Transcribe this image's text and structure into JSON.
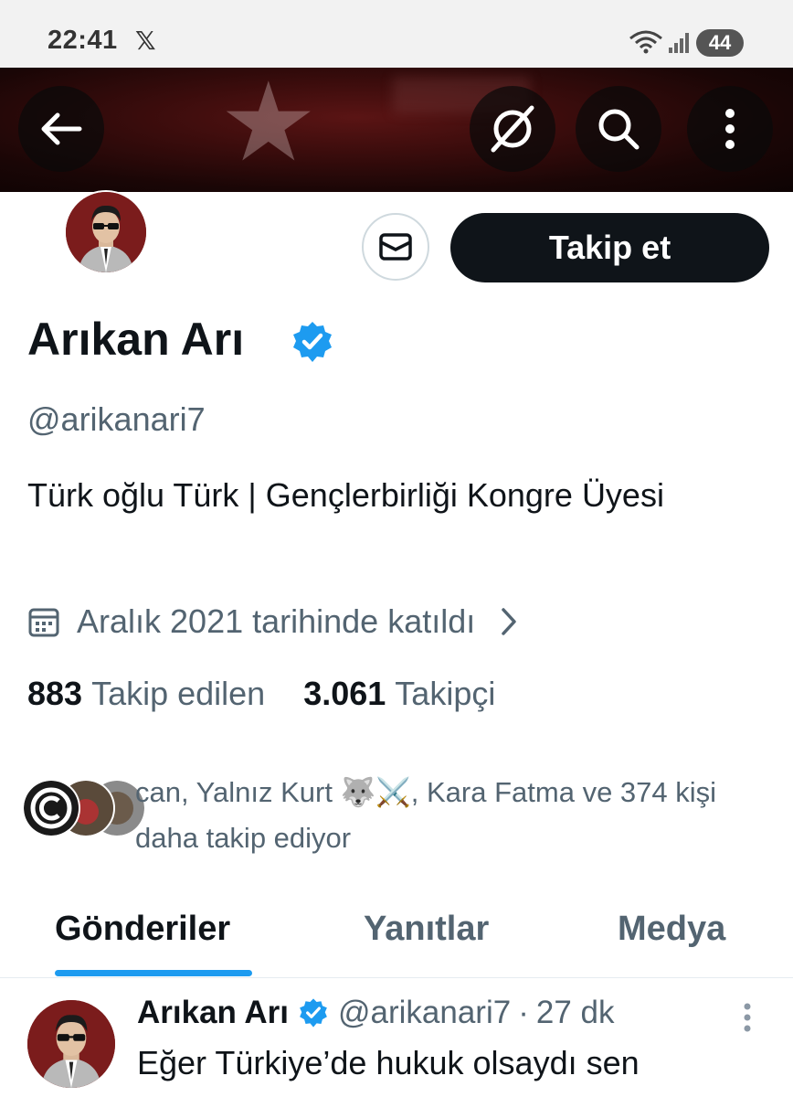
{
  "status_bar": {
    "time": "22:41",
    "x_logo": "𝕏",
    "battery": "44"
  },
  "topbar": {
    "icons": [
      "back-arrow-icon",
      "grok-icon",
      "search-icon",
      "more-vertical-icon"
    ]
  },
  "profile": {
    "follow_label": "Takip et",
    "name": "Arıkan Arı",
    "handle": "@arikanari7",
    "bio": "Türk oğlu Türk | Gençlerbirliği Kongre Üyesi",
    "joined": "Aralık 2021 tarihinde katıldı",
    "following_count": "883",
    "following_label": "Takip edilen",
    "followers_count": "3.061",
    "followers_label": "Takipçi",
    "followed_by": "can, Yalnız Kurt 🐺⚔️, Kara Fatma ve 374 kişi daha takip ediyor"
  },
  "tabs": [
    {
      "label": "Gönderiler",
      "active": true
    },
    {
      "label": "Yanıtlar",
      "active": false
    },
    {
      "label": "Medya",
      "active": false
    }
  ],
  "tweet": {
    "name": "Arıkan Arı",
    "handle": "@arikanari7",
    "time": "27 dk",
    "separator": "·",
    "text": "Eğer Türkiye’de hukuk olsaydı sen"
  },
  "colors": {
    "accent": "#1d9bf0",
    "text": "#0f1419",
    "muted": "#536471",
    "button": "#0f1419"
  }
}
